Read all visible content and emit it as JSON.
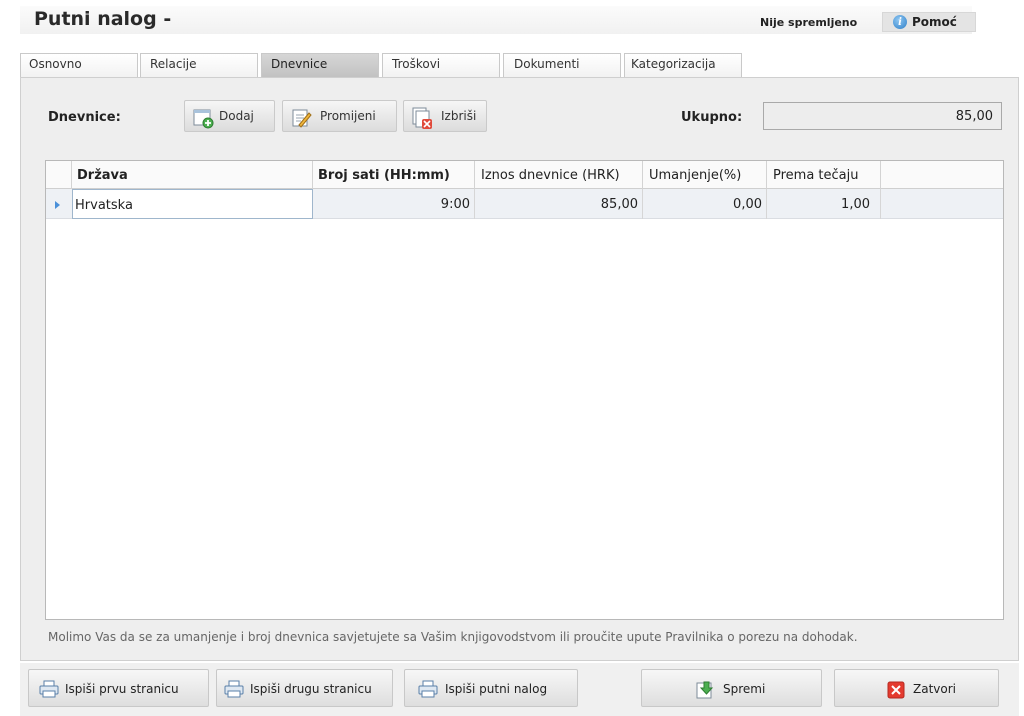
{
  "header": {
    "title": "Putni nalog -",
    "save_status": "Nije spremljeno",
    "help_label": "Pomoć"
  },
  "tabs": [
    {
      "label": "Osnovno",
      "active": false
    },
    {
      "label": "Relacije",
      "active": false
    },
    {
      "label": "Dnevnice",
      "active": true
    },
    {
      "label": "Troškovi",
      "active": false
    },
    {
      "label": "Dokumenti",
      "active": false
    },
    {
      "label": "Kategorizacija",
      "active": false
    }
  ],
  "toolbar": {
    "section_label": "Dnevnice:",
    "add_label": "Dodaj",
    "edit_label": "Promijeni",
    "delete_label": "Izbriši",
    "total_label": "Ukupno:",
    "total_value": "85,00"
  },
  "grid": {
    "columns": [
      "Država",
      "Broj sati (HH:mm)",
      "Iznos dnevnice (HRK)",
      "Umanjenje(%)",
      "Prema tečaju"
    ],
    "rows": [
      {
        "country": "Hrvatska",
        "hours": "9:00",
        "amount": "85,00",
        "reduction": "0,00",
        "rate": "1,00"
      }
    ]
  },
  "note": "Molimo Vas da se za umanjenje i broj dnevnica savjetujete sa Vašim knjigovodstvom ili proučite upute Pravilnika o porezu na dohodak.",
  "footer": {
    "print_first": "Ispiši prvu stranicu",
    "print_second": "Ispiši drugu stranicu",
    "print_order": "Ispiši putni nalog",
    "save": "Spremi",
    "close": "Zatvori"
  },
  "icons": {
    "help": "info-icon",
    "add": "add-document-icon",
    "edit": "edit-document-icon",
    "delete": "delete-document-icon",
    "print": "printer-icon",
    "save": "save-document-icon",
    "close": "close-icon"
  }
}
